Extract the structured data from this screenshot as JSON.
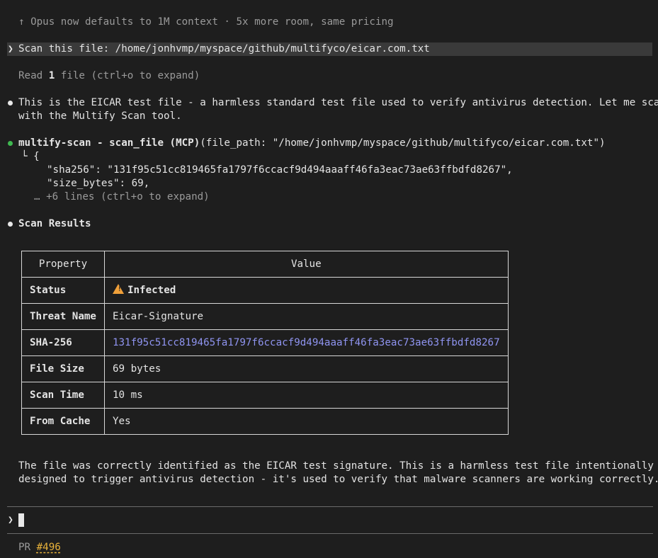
{
  "notice": "↑ Opus now defaults to 1M context · 5x more room, same pricing",
  "user_prompt": {
    "chevron": "❯",
    "text": "Scan this file: /home/jonhvmp/myspace/github/multifyco/eicar.com.txt"
  },
  "read_line": {
    "prefix": "Read ",
    "count": "1",
    "suffix": " file (ctrl+o to expand)"
  },
  "message1": {
    "line1": "This is the EICAR test file - a harmless standard test file used to verify antivirus detection. Let me scan it",
    "line2": "with the Multify Scan tool."
  },
  "tool_call": {
    "name": "multify-scan - scan_file (MCP)",
    "args": "(file_path: \"/home/jonhvmp/myspace/github/multifyco/eicar.com.txt\")",
    "out_open": "└ {",
    "out_sha": "\"sha256\": \"131f95c51cc819465fa1797f6ccacf9d494aaaff46fa3eac73ae63ffbdfd8267\",",
    "out_size": "\"size_bytes\": 69,",
    "out_more": "… +6 lines (ctrl+o to expand)"
  },
  "results_heading": "Scan Results",
  "table": {
    "header": {
      "property": "Property",
      "value": "Value"
    },
    "rows": [
      {
        "label": "Status",
        "value": "Infected"
      },
      {
        "label": "Threat Name",
        "value": "Eicar-Signature"
      },
      {
        "label": "SHA-256",
        "value": "131f95c51cc819465fa1797f6ccacf9d494aaaff46fa3eac73ae63ffbdfd8267"
      },
      {
        "label": "File Size",
        "value": "69 bytes"
      },
      {
        "label": "Scan Time",
        "value": "10 ms"
      },
      {
        "label": "From Cache",
        "value": "Yes"
      }
    ]
  },
  "conclusion": {
    "line1": "The file was correctly identified as the EICAR test signature. This is a harmless test file intentionally",
    "line2": "designed to trigger antivirus detection - it's used to verify that malware scanners are working correctly."
  },
  "input": {
    "chevron": "❯",
    "value": ""
  },
  "footer": {
    "pr_label": "PR ",
    "pr_link": "#496"
  },
  "colors": {
    "background": "#1e1e1e",
    "bullet_white": "#e8e8e8",
    "bullet_green": "#3fb950",
    "hash": "#8f94f0",
    "warning": "#f0a03a",
    "pr_link": "#e8b23a"
  }
}
